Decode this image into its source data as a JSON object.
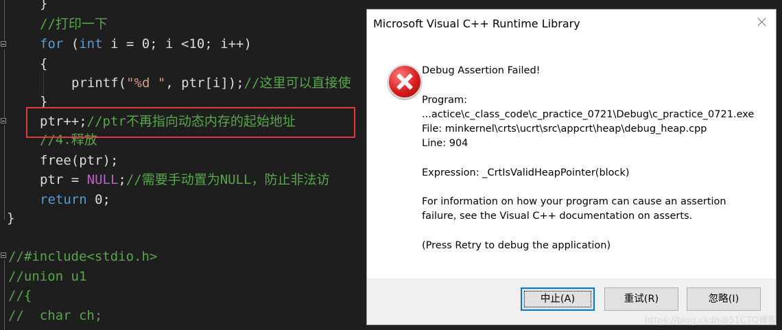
{
  "editor": {
    "lines": [
      {
        "id": "l0",
        "segments": [
          {
            "c": "txt",
            "t": "}"
          }
        ]
      },
      {
        "id": "l1",
        "segments": [
          {
            "c": "cm",
            "t": "//打印一下"
          }
        ]
      },
      {
        "id": "l2",
        "segments": [
          {
            "c": "kw",
            "t": "for"
          },
          {
            "c": "txt",
            "t": " ("
          },
          {
            "c": "kw",
            "t": "int"
          },
          {
            "c": "txt",
            "t": " i = 0; i <10; i++)"
          }
        ]
      },
      {
        "id": "l3",
        "segments": [
          {
            "c": "txt",
            "t": "{"
          }
        ]
      },
      {
        "id": "l4",
        "segments": [
          {
            "c": "txt",
            "t": "printf("
          },
          {
            "c": "str",
            "t": "\"%d \""
          },
          {
            "c": "txt",
            "t": ", ptr[i]);"
          },
          {
            "c": "cm",
            "t": "//这里可以直接使"
          }
        ]
      },
      {
        "id": "l5",
        "segments": [
          {
            "c": "txt",
            "t": "}"
          }
        ]
      },
      {
        "id": "l6",
        "segments": [
          {
            "c": "txt",
            "t": "ptr++;"
          },
          {
            "c": "cm",
            "t": "//ptr不再指向动态内存的起始地址"
          }
        ]
      },
      {
        "id": "l7",
        "segments": [
          {
            "c": "cm",
            "t": "//4.释放"
          }
        ]
      },
      {
        "id": "l8",
        "segments": [
          {
            "c": "txt",
            "t": "free(ptr);"
          }
        ]
      },
      {
        "id": "l9",
        "segments": [
          {
            "c": "txt",
            "t": "ptr = "
          },
          {
            "c": "mac",
            "t": "NULL"
          },
          {
            "c": "txt",
            "t": ";"
          },
          {
            "c": "cm",
            "t": "//需要手动置为NULL，防止非法访"
          }
        ]
      },
      {
        "id": "l10",
        "segments": [
          {
            "c": "kw",
            "t": "return"
          },
          {
            "c": "txt",
            "t": " 0;"
          }
        ]
      },
      {
        "id": "l11",
        "segments": [
          {
            "c": "txt",
            "t": "}"
          }
        ]
      },
      {
        "id": "l12",
        "segments": [
          {
            "c": "cm",
            "t": "//#include<stdio.h>"
          }
        ]
      },
      {
        "id": "l13",
        "segments": [
          {
            "c": "cm",
            "t": "//union u1"
          }
        ]
      },
      {
        "id": "l14",
        "segments": [
          {
            "c": "cm",
            "t": "//{"
          }
        ]
      },
      {
        "id": "l15",
        "segments": [
          {
            "c": "cm",
            "t": "//  char ch;"
          }
        ]
      }
    ]
  },
  "dialog": {
    "title": "Microsoft Visual C++ Runtime Library",
    "heading": "Debug Assertion Failed!",
    "program_label": "Program:",
    "program_path": "...actice\\c_class_code\\c_practice_0721\\Debug\\c_practice_0721.exe",
    "file_line": "File: minkernel\\crts\\ucrt\\src\\appcrt\\heap\\debug_heap.cpp",
    "line_line": "Line: 904",
    "expression": "Expression: _CrtIsValidHeapPointer(block)",
    "info_1": "For information on how your program can cause an assertion",
    "info_2": "failure, see the Visual C++ documentation on asserts.",
    "hint": "(Press Retry to debug the application)",
    "buttons": {
      "abort": "中止(A)",
      "retry": "重试(R)",
      "ignore": "忽略(I)"
    }
  },
  "watermark": "https://blog.csdn@51CTO博客"
}
